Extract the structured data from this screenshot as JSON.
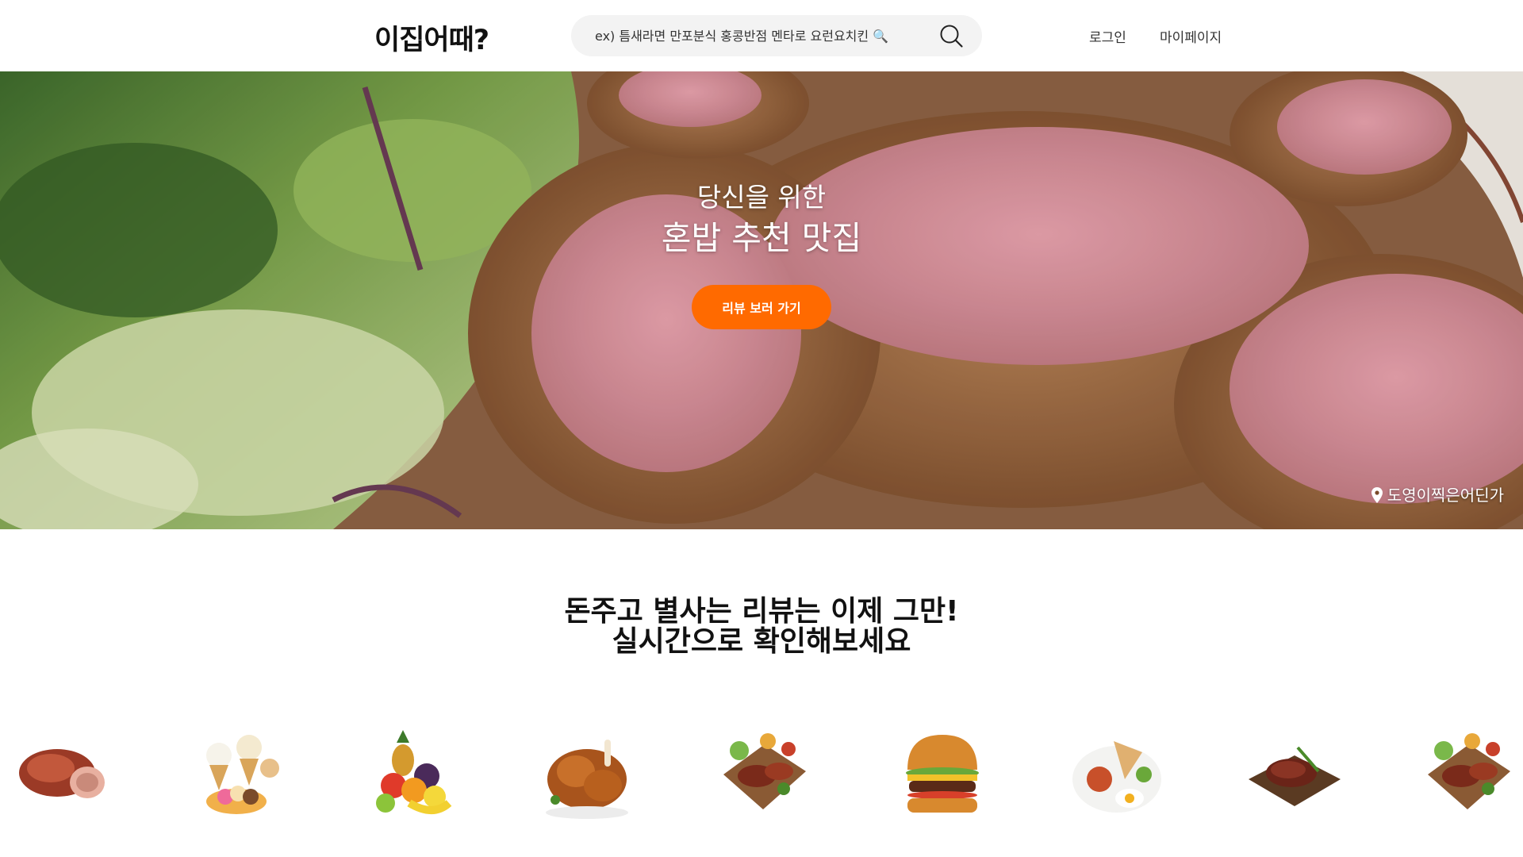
{
  "header": {
    "logo": "이집어때?",
    "search_placeholder": "ex) 틈새라면 만포분식 홍콩반점 멘타로 요런요치킨 🔍",
    "nav_login": "로그인",
    "nav_mypage": "마이페이지"
  },
  "hero": {
    "subtitle": "당신을 위한",
    "title": "혼밥 추천 맛집",
    "button_label": "리뷰 보러 가기",
    "location": "도영이찍은어딘가",
    "button_color": "#ff6a00"
  },
  "section": {
    "title_line1": "돈주고 별사는 리뷰는 이제 그만!",
    "title_line2": "실시간으로 확인해보세요"
  },
  "foods": [
    {
      "icon": "roast-meat-icon"
    },
    {
      "icon": "ice-cream-icon"
    },
    {
      "icon": "fruit-icon"
    },
    {
      "icon": "roast-chicken-icon"
    },
    {
      "icon": "steak-platter-icon"
    },
    {
      "icon": "burger-icon"
    },
    {
      "icon": "breakfast-plate-icon"
    },
    {
      "icon": "steak-board-icon"
    },
    {
      "icon": "steak-platter-icon"
    }
  ]
}
